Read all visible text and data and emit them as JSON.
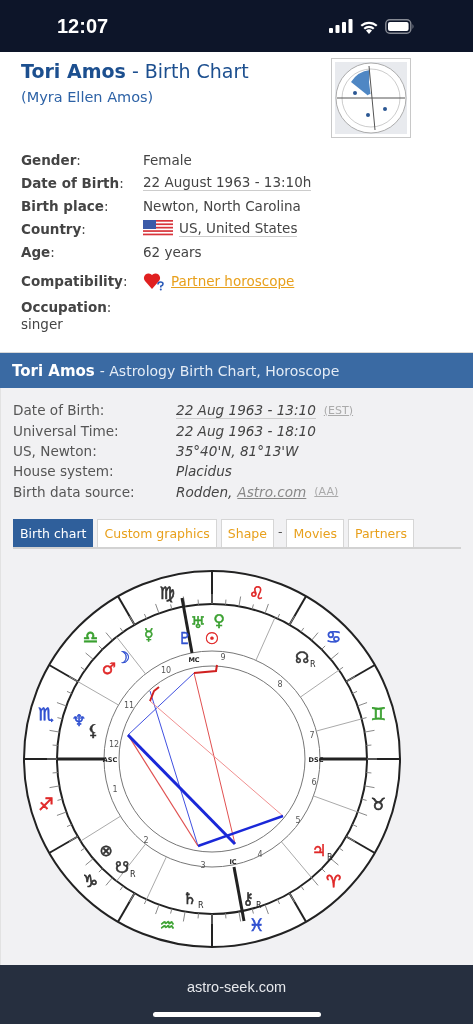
{
  "status_bar": {
    "time": "12:07"
  },
  "profile": {
    "name": "Tori Amos",
    "title_suffix": "- Birth Chart",
    "birth_name": "(Myra Ellen Amos)",
    "facts": [
      {
        "label": "**Gender**:",
        "value": "Female",
        "kind": "plain"
      },
      {
        "label": "**Date of Birth**:",
        "value": "22 August 1963 - 13:10h",
        "kind": "underlined"
      },
      {
        "label": "**Birth place**:",
        "value": "Newton, North Carolina",
        "kind": "plain"
      },
      {
        "label": "**Country**:",
        "value": "US, United States",
        "kind": "flag"
      },
      {
        "label": "**Age**:",
        "value": "62 years",
        "kind": "plain"
      },
      {
        "label": "**Compatibility**:",
        "value": "Partner horoscope",
        "kind": "link"
      }
    ],
    "occupation": {
      "label": "**Occupation**:",
      "value": "singer"
    }
  },
  "chart_header": {
    "name": "Tori Amos",
    "subtitle": "- Astrology Birth Chart, Horoscope"
  },
  "details": [
    {
      "label": "Date of Birth:",
      "value": "22 Aug 1963 - 13:10",
      "note": "(EST)"
    },
    {
      "label": "Universal Time:",
      "value": "22 Aug 1963 - 18:10"
    },
    {
      "label": "US, Newton:",
      "value": "35°40'N, 81°13'W"
    },
    {
      "label": "House system:",
      "value": "Placidus"
    },
    {
      "label": "Birth data source:",
      "value": "Rodden,",
      "link": "Astro.com",
      "note": "(AA)"
    }
  ],
  "tabs": [
    {
      "kind": "tab",
      "label": "Birth chart",
      "selected": true
    },
    {
      "kind": "tab",
      "label": "Custom graphics",
      "selected": false
    },
    {
      "kind": "tab",
      "label": "Shape",
      "selected": false
    },
    {
      "kind": "separator",
      "label": "-"
    },
    {
      "kind": "tab",
      "label": "Movies",
      "selected": false
    },
    {
      "kind": "tab",
      "label": "Partners",
      "selected": false
    }
  ],
  "wheel": {
    "signs": [
      {
        "glyph": "♈",
        "color": "#e02828"
      },
      {
        "glyph": "♉",
        "color": "#333333"
      },
      {
        "glyph": "♊",
        "color": "#3aa030"
      },
      {
        "glyph": "♋",
        "color": "#3050d0"
      },
      {
        "glyph": "♌",
        "color": "#e02828"
      },
      {
        "glyph": "♍",
        "color": "#333333"
      },
      {
        "glyph": "♎",
        "color": "#3aa030"
      },
      {
        "glyph": "♏",
        "color": "#3050d0"
      },
      {
        "glyph": "♐",
        "color": "#e02828"
      },
      {
        "glyph": "♑",
        "color": "#333333"
      },
      {
        "glyph": "♒",
        "color": "#3aa030"
      },
      {
        "glyph": "♓",
        "color": "#3050d0"
      }
    ],
    "houses": [
      "1",
      "2",
      "3",
      "4",
      "5",
      "6",
      "7",
      "8",
      "9",
      "10",
      "11",
      "12"
    ],
    "angles": [
      "ASC",
      "MC",
      "DSC",
      "IC"
    ],
    "points": [
      {
        "glyph": "♀",
        "color": "#3aa030"
      },
      {
        "glyph": "♅",
        "color": "#3aa030"
      },
      {
        "glyph": "☿",
        "color": "#3aa030"
      },
      {
        "glyph": "♇",
        "color": "#3050d0"
      },
      {
        "glyph": "☉",
        "color": "#e02828"
      },
      {
        "glyph": "☽",
        "color": "#3050d0"
      },
      {
        "glyph": "☊",
        "color": "#333333",
        "mark": "R"
      },
      {
        "glyph": "♂",
        "color": "#e02828"
      },
      {
        "glyph": "♆",
        "color": "#3050d0"
      },
      {
        "glyph": "⚸",
        "color": "#333333"
      },
      {
        "glyph": "♃",
        "color": "#e02828",
        "mark": "R"
      },
      {
        "glyph": "⊗",
        "color": "#333333"
      },
      {
        "glyph": "☋",
        "color": "#333333",
        "mark": "R"
      },
      {
        "glyph": "♄",
        "color": "#333333",
        "mark": "R"
      },
      {
        "glyph": "⚷",
        "color": "#333333",
        "mark": "R"
      }
    ]
  },
  "footer": {
    "url": "astro-seek.com"
  }
}
